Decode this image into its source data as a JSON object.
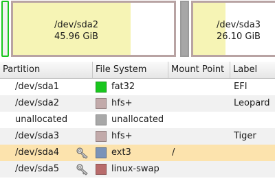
{
  "graphic": {
    "sda1": {
      "color": "#19c61e"
    },
    "sda2": {
      "name": "/dev/sda2",
      "size": "45.96 GiB",
      "used_fraction": 0.73
    },
    "unallocated": {
      "color": "#a7a7a7"
    },
    "sda3": {
      "name": "/dev/sda3",
      "size": "26.10 GiB",
      "used_fraction": 0.38
    }
  },
  "table": {
    "headers": {
      "partition": "Partition",
      "filesystem": "File System",
      "mount_point": "Mount Point",
      "label": "Label"
    },
    "rows": [
      {
        "partition": "/dev/sda1",
        "filesystem": "fat32",
        "fs_color": "#19c61e",
        "mount_point": "",
        "label": "EFI",
        "locked": false,
        "selected": false
      },
      {
        "partition": "/dev/sda2",
        "filesystem": "hfs+",
        "fs_color": "#c2aaaa",
        "mount_point": "",
        "label": "Leopard",
        "locked": false,
        "selected": false
      },
      {
        "partition": "unallocated",
        "filesystem": "unallocated",
        "fs_color": "#a8a8a8",
        "mount_point": "",
        "label": "",
        "locked": false,
        "selected": false
      },
      {
        "partition": "/dev/sda3",
        "filesystem": "hfs+",
        "fs_color": "#c2aaaa",
        "mount_point": "",
        "label": "Tiger",
        "locked": false,
        "selected": false
      },
      {
        "partition": "/dev/sda4",
        "filesystem": "ext3",
        "fs_color": "#7a93b8",
        "mount_point": "/",
        "label": "",
        "locked": true,
        "selected": true
      },
      {
        "partition": "/dev/sda5",
        "filesystem": "linux-swap",
        "fs_color": "#b86b6b",
        "mount_point": "",
        "label": "",
        "locked": true,
        "selected": false
      }
    ]
  },
  "icons": {
    "lock": "key-icon"
  }
}
